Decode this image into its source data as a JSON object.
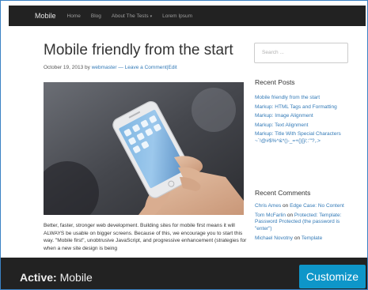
{
  "nav": {
    "brand": "Mobile",
    "items": [
      "Home",
      "Blog",
      "About The Tests",
      "Lorem Ipsum"
    ],
    "dropdown_caret": "▾"
  },
  "post": {
    "title": "Mobile friendly from the start",
    "date": "October 19, 2013",
    "by": "by",
    "author": "webmaster",
    "sep1": "—",
    "comment_link": "Leave a Comment",
    "sep2": "|",
    "edit_link": "Edit",
    "excerpt": "Better, faster, stronger web development. Building sites for mobile first means it will ALWAYS be usable on bigger screens. Because of this, we encourage you to start this way. \"Mobile first\", unobtrusive JavaScript, and progressive enhancement (strategies for when a new site design is being"
  },
  "sidebar": {
    "search_placeholder": "Search ...",
    "recent_posts_title": "Recent Posts",
    "recent_posts": [
      "Mobile friendly from the start",
      "Markup: HTML Tags and Formatting",
      "Markup: Image Alignment",
      "Markup: Text Alignment",
      "Markup: Title With Special Characters ~`!@#$%^&*()-_=+{}[]/;:'\"?,.>"
    ],
    "recent_comments_title": "Recent Comments",
    "recent_comments": [
      {
        "author": "Chris Ames",
        "on": "on",
        "post": "Edge Case: No Content"
      },
      {
        "author": "Tom McFarlin",
        "on": "on",
        "post": "Protected: Template: Password Protected (the password is \"enter\")"
      },
      {
        "author": "Michael Novotny",
        "on": "on",
        "post": "Template"
      }
    ]
  },
  "footer": {
    "active_label": "Active:",
    "active_theme": "Mobile",
    "customize_label": "Customize"
  },
  "colors": {
    "navbar": "#222222",
    "link": "#337ab7",
    "customize_button": "#0e96c9"
  }
}
